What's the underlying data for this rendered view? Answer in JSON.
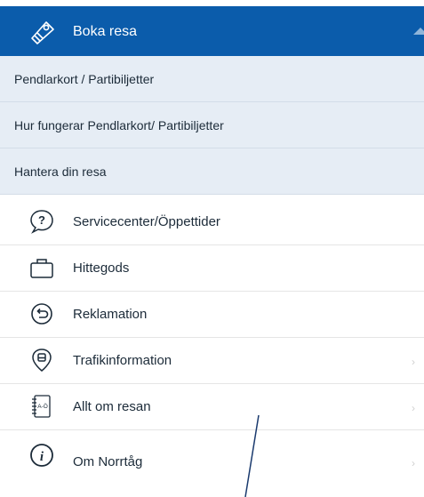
{
  "header": {
    "title": "Boka resa",
    "icon": "ticket-icon",
    "accent": "#0b5cab"
  },
  "submenu": [
    {
      "label": "Pendlarkort / Partibiljetter"
    },
    {
      "label": "Hur fungerar Pendlarkort/ Partibiljetter"
    },
    {
      "label": "Hantera din resa"
    }
  ],
  "items": [
    {
      "label": "Servicecenter/Öppettider",
      "icon": "question-chat-icon"
    },
    {
      "label": "Hittegods",
      "icon": "bag-icon"
    },
    {
      "label": "Reklamation",
      "icon": "return-arrow-icon"
    },
    {
      "label": "Trafikinformation",
      "icon": "location-train-icon"
    },
    {
      "label": "Allt om resan",
      "icon": "notebook-az-icon"
    },
    {
      "label": "Om Norrtåg",
      "icon": "info-icon"
    }
  ]
}
